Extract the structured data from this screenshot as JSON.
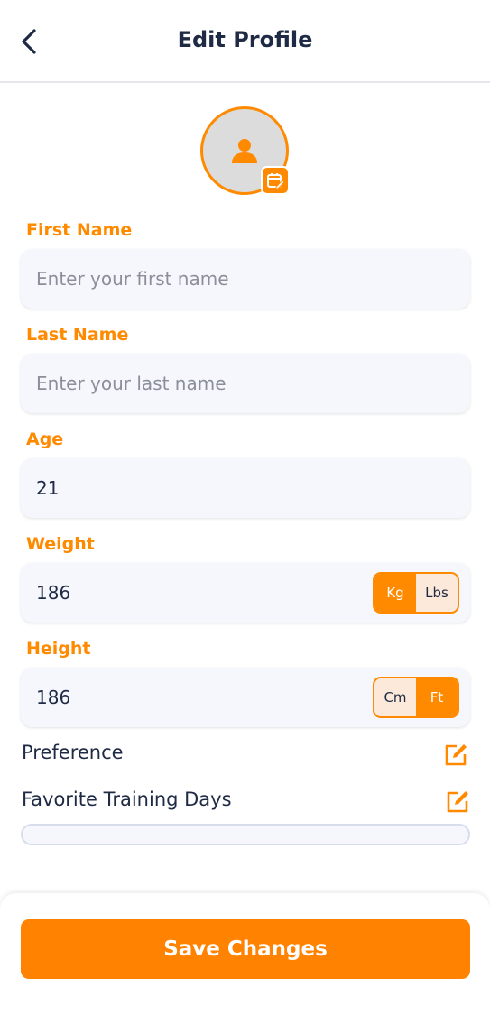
{
  "header": {
    "title": "Edit Profile",
    "back_icon": "chevron-left-icon"
  },
  "avatar": {
    "icon": "person-icon",
    "edit_icon": "edit-calendar-icon"
  },
  "form": {
    "first_name": {
      "label": "First Name",
      "value": "",
      "placeholder": "Enter your first name"
    },
    "last_name": {
      "label": "Last Name",
      "value": "",
      "placeholder": "Enter your last name"
    },
    "age": {
      "label": "Age",
      "value": "21",
      "placeholder": ""
    },
    "weight": {
      "label": "Weight",
      "value": "186",
      "placeholder": "",
      "units": [
        {
          "label": "Kg",
          "active": true
        },
        {
          "label": "Lbs",
          "active": false
        }
      ]
    },
    "height": {
      "label": "Height",
      "value": "186",
      "placeholder": "",
      "units": [
        {
          "label": "Cm",
          "active": false
        },
        {
          "label": "Ft",
          "active": true
        }
      ]
    }
  },
  "sections": {
    "preference": {
      "label": "Preference",
      "icon": "edit-icon"
    },
    "training_days": {
      "label": "Favorite Training Days",
      "icon": "edit-icon"
    }
  },
  "footer": {
    "save_label": "Save Changes"
  },
  "colors": {
    "accent": "#ff8a00",
    "text_dark": "#1f2a44",
    "field_bg": "#f5f7fd",
    "placeholder": "#8a8f99"
  }
}
